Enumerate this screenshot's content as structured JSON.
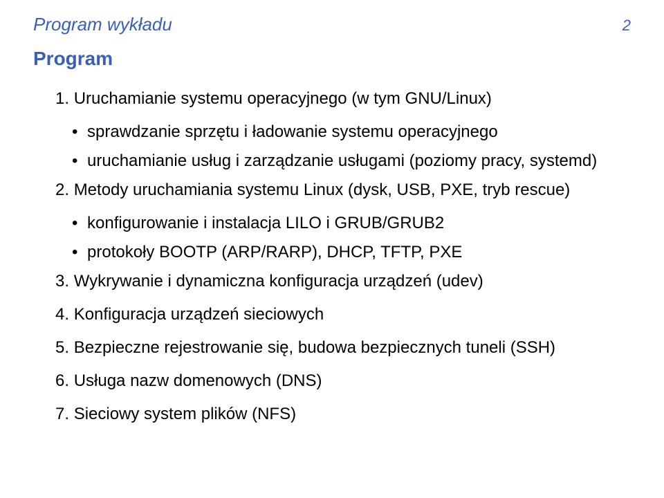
{
  "header": {
    "title": "Program wykładu",
    "page": "2"
  },
  "section_title": "Program",
  "items": [
    {
      "num": "1.",
      "text": "Uruchamianie systemu operacyjnego (w tym GNU/Linux)",
      "subs": [
        "sprawdzanie sprzętu i ładowanie systemu operacyjnego",
        "uruchamianie usług i zarządzanie usługami (poziomy pracy, systemd)"
      ]
    },
    {
      "num": "2.",
      "text": "Metody uruchamiania systemu Linux (dysk, USB, PXE, tryb rescue)",
      "subs": [
        "konfigurowanie i instalacja LILO i GRUB/GRUB2",
        "protokoły BOOTP (ARP/RARP), DHCP, TFTP, PXE"
      ]
    },
    {
      "num": "3.",
      "text": "Wykrywanie i dynamiczna konfiguracja urządzeń (udev)",
      "subs": []
    },
    {
      "num": "4.",
      "text": "Konfiguracja urządzeń sieciowych",
      "subs": []
    },
    {
      "num": "5.",
      "text": "Bezpieczne rejestrowanie się, budowa bezpiecznych tuneli (SSH)",
      "subs": []
    },
    {
      "num": "6.",
      "text": "Usługa nazw domenowych (DNS)",
      "subs": []
    },
    {
      "num": "7.",
      "text": "Sieciowy system plików (NFS)",
      "subs": []
    }
  ],
  "bullet": "•"
}
